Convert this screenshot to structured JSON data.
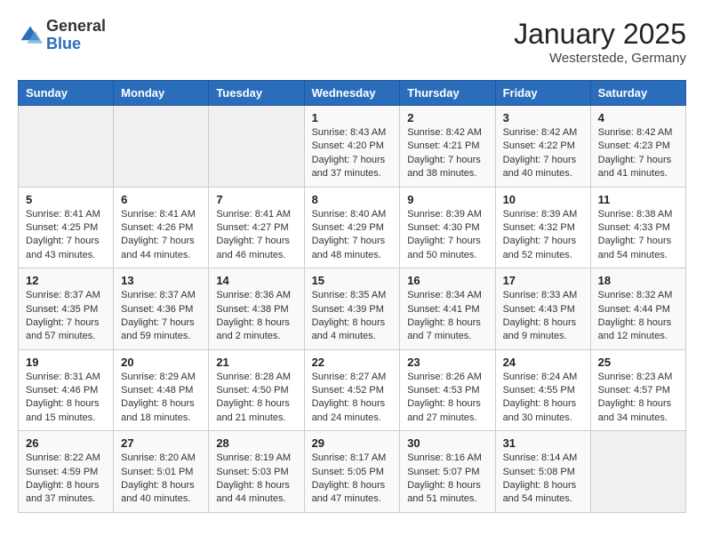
{
  "logo": {
    "general": "General",
    "blue": "Blue"
  },
  "header": {
    "title": "January 2025",
    "location": "Westerstede, Germany"
  },
  "weekdays": [
    "Sunday",
    "Monday",
    "Tuesday",
    "Wednesday",
    "Thursday",
    "Friday",
    "Saturday"
  ],
  "weeks": [
    [
      {
        "day": "",
        "info": ""
      },
      {
        "day": "",
        "info": ""
      },
      {
        "day": "",
        "info": ""
      },
      {
        "day": "1",
        "info": "Sunrise: 8:43 AM\nSunset: 4:20 PM\nDaylight: 7 hours and 37 minutes."
      },
      {
        "day": "2",
        "info": "Sunrise: 8:42 AM\nSunset: 4:21 PM\nDaylight: 7 hours and 38 minutes."
      },
      {
        "day": "3",
        "info": "Sunrise: 8:42 AM\nSunset: 4:22 PM\nDaylight: 7 hours and 40 minutes."
      },
      {
        "day": "4",
        "info": "Sunrise: 8:42 AM\nSunset: 4:23 PM\nDaylight: 7 hours and 41 minutes."
      }
    ],
    [
      {
        "day": "5",
        "info": "Sunrise: 8:41 AM\nSunset: 4:25 PM\nDaylight: 7 hours and 43 minutes."
      },
      {
        "day": "6",
        "info": "Sunrise: 8:41 AM\nSunset: 4:26 PM\nDaylight: 7 hours and 44 minutes."
      },
      {
        "day": "7",
        "info": "Sunrise: 8:41 AM\nSunset: 4:27 PM\nDaylight: 7 hours and 46 minutes."
      },
      {
        "day": "8",
        "info": "Sunrise: 8:40 AM\nSunset: 4:29 PM\nDaylight: 7 hours and 48 minutes."
      },
      {
        "day": "9",
        "info": "Sunrise: 8:39 AM\nSunset: 4:30 PM\nDaylight: 7 hours and 50 minutes."
      },
      {
        "day": "10",
        "info": "Sunrise: 8:39 AM\nSunset: 4:32 PM\nDaylight: 7 hours and 52 minutes."
      },
      {
        "day": "11",
        "info": "Sunrise: 8:38 AM\nSunset: 4:33 PM\nDaylight: 7 hours and 54 minutes."
      }
    ],
    [
      {
        "day": "12",
        "info": "Sunrise: 8:37 AM\nSunset: 4:35 PM\nDaylight: 7 hours and 57 minutes."
      },
      {
        "day": "13",
        "info": "Sunrise: 8:37 AM\nSunset: 4:36 PM\nDaylight: 7 hours and 59 minutes."
      },
      {
        "day": "14",
        "info": "Sunrise: 8:36 AM\nSunset: 4:38 PM\nDaylight: 8 hours and 2 minutes."
      },
      {
        "day": "15",
        "info": "Sunrise: 8:35 AM\nSunset: 4:39 PM\nDaylight: 8 hours and 4 minutes."
      },
      {
        "day": "16",
        "info": "Sunrise: 8:34 AM\nSunset: 4:41 PM\nDaylight: 8 hours and 7 minutes."
      },
      {
        "day": "17",
        "info": "Sunrise: 8:33 AM\nSunset: 4:43 PM\nDaylight: 8 hours and 9 minutes."
      },
      {
        "day": "18",
        "info": "Sunrise: 8:32 AM\nSunset: 4:44 PM\nDaylight: 8 hours and 12 minutes."
      }
    ],
    [
      {
        "day": "19",
        "info": "Sunrise: 8:31 AM\nSunset: 4:46 PM\nDaylight: 8 hours and 15 minutes."
      },
      {
        "day": "20",
        "info": "Sunrise: 8:29 AM\nSunset: 4:48 PM\nDaylight: 8 hours and 18 minutes."
      },
      {
        "day": "21",
        "info": "Sunrise: 8:28 AM\nSunset: 4:50 PM\nDaylight: 8 hours and 21 minutes."
      },
      {
        "day": "22",
        "info": "Sunrise: 8:27 AM\nSunset: 4:52 PM\nDaylight: 8 hours and 24 minutes."
      },
      {
        "day": "23",
        "info": "Sunrise: 8:26 AM\nSunset: 4:53 PM\nDaylight: 8 hours and 27 minutes."
      },
      {
        "day": "24",
        "info": "Sunrise: 8:24 AM\nSunset: 4:55 PM\nDaylight: 8 hours and 30 minutes."
      },
      {
        "day": "25",
        "info": "Sunrise: 8:23 AM\nSunset: 4:57 PM\nDaylight: 8 hours and 34 minutes."
      }
    ],
    [
      {
        "day": "26",
        "info": "Sunrise: 8:22 AM\nSunset: 4:59 PM\nDaylight: 8 hours and 37 minutes."
      },
      {
        "day": "27",
        "info": "Sunrise: 8:20 AM\nSunset: 5:01 PM\nDaylight: 8 hours and 40 minutes."
      },
      {
        "day": "28",
        "info": "Sunrise: 8:19 AM\nSunset: 5:03 PM\nDaylight: 8 hours and 44 minutes."
      },
      {
        "day": "29",
        "info": "Sunrise: 8:17 AM\nSunset: 5:05 PM\nDaylight: 8 hours and 47 minutes."
      },
      {
        "day": "30",
        "info": "Sunrise: 8:16 AM\nSunset: 5:07 PM\nDaylight: 8 hours and 51 minutes."
      },
      {
        "day": "31",
        "info": "Sunrise: 8:14 AM\nSunset: 5:08 PM\nDaylight: 8 hours and 54 minutes."
      },
      {
        "day": "",
        "info": ""
      }
    ]
  ]
}
